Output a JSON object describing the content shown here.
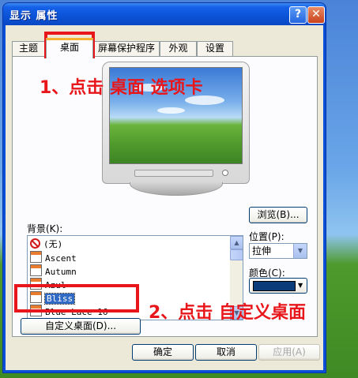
{
  "window": {
    "title": "显示 属性",
    "help_label": "?",
    "close_label": "✕"
  },
  "tabs": [
    {
      "label": "主题"
    },
    {
      "label": "桌面"
    },
    {
      "label": "屏幕保护程序"
    },
    {
      "label": "外观"
    },
    {
      "label": "设置"
    }
  ],
  "active_tab": "桌面",
  "background": {
    "label": "背景(K):",
    "items": [
      {
        "label": "(无)",
        "icon": "none-icon"
      },
      {
        "label": "Ascent",
        "icon": "image-file-icon"
      },
      {
        "label": "Autumn",
        "icon": "image-file-icon"
      },
      {
        "label": "Azul",
        "icon": "image-file-icon"
      },
      {
        "label": "Bliss",
        "icon": "image-file-icon"
      },
      {
        "label": "Blue Lace 16",
        "icon": "image-file-icon"
      }
    ],
    "selected": "Bliss"
  },
  "side": {
    "browse_label": "浏览(B)...",
    "position_label": "位置(P):",
    "position_value": "拉伸",
    "color_label": "颜色(C):",
    "color_value": "#0a3c7a"
  },
  "customize_label": "自定义桌面(D)...",
  "footer": {
    "ok_label": "确定",
    "cancel_label": "取消",
    "apply_label": "应用(A)"
  },
  "annotations": {
    "step1": "1、点击 桌面 选项卡",
    "step2": "2、点击 自定义桌面"
  },
  "colors": {
    "annotation": "#e8161a",
    "title_bar": "#0a52d6",
    "selection": "#316ac5"
  }
}
